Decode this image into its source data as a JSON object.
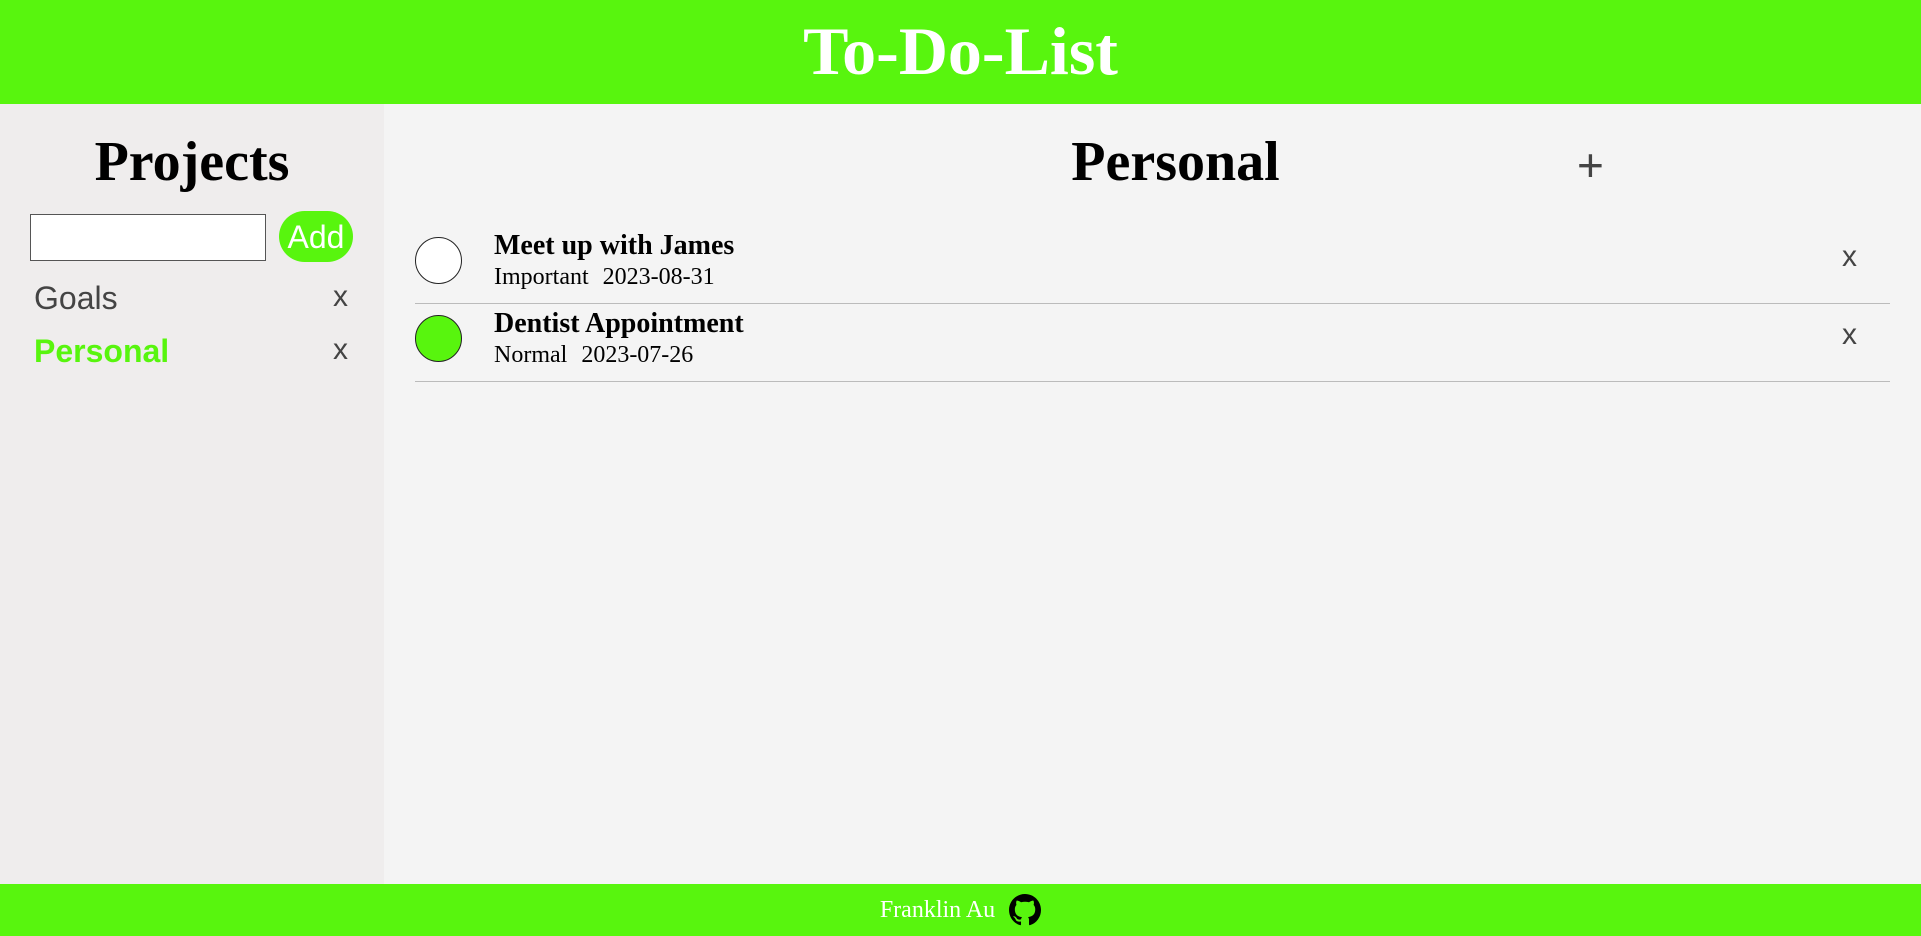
{
  "header": {
    "title": "To-Do-List"
  },
  "sidebar": {
    "title": "Projects",
    "input_value": "",
    "add_label": "Add",
    "projects": [
      {
        "name": "Goals",
        "delete_label": "x",
        "active": false
      },
      {
        "name": "Personal",
        "delete_label": "x",
        "active": true
      }
    ]
  },
  "main": {
    "title": "Personal",
    "add_task_label": "+",
    "tasks": [
      {
        "title": "Meet up with James",
        "priority": "Important",
        "date": "2023-08-31",
        "completed": false,
        "delete_label": "x"
      },
      {
        "title": "Dentist Appointment",
        "priority": "Normal",
        "date": "2023-07-26",
        "completed": true,
        "delete_label": "x"
      }
    ]
  },
  "footer": {
    "author": "Franklin Au",
    "icon": "github-icon"
  },
  "colors": {
    "accent": "#58f50e",
    "sidebar_bg": "#efeded",
    "main_bg": "#f4f4f4"
  }
}
